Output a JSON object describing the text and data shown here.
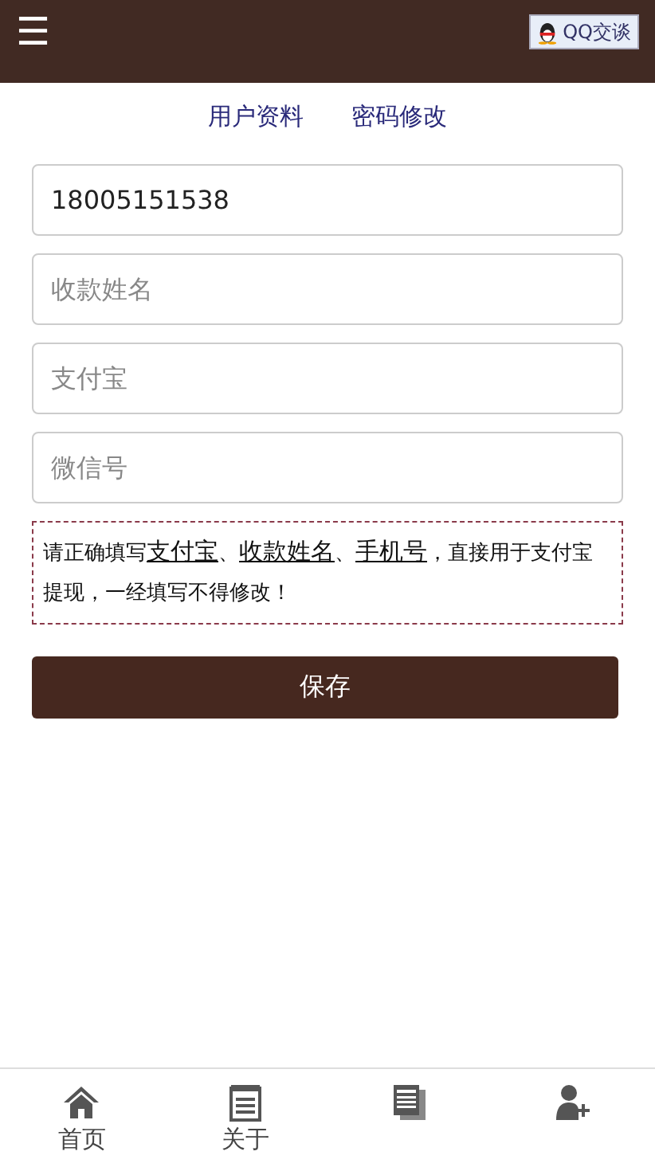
{
  "header": {
    "menu_icon": "☰",
    "qq_button": "QQ交谈"
  },
  "tabs": [
    {
      "label": "用户资料"
    },
    {
      "label": "密码修改"
    }
  ],
  "fields": [
    {
      "value": "18005151538"
    },
    {
      "placeholder": "收款姓名"
    },
    {
      "placeholder": "支付宝"
    },
    {
      "placeholder": "微信号"
    }
  ],
  "notice": [
    {
      "text": "请正确填写",
      "underline": false
    },
    {
      "text": "支付宝",
      "underline": true
    },
    {
      "text": "、",
      "underline": false
    },
    {
      "text": "收款姓名",
      "underline": true
    },
    {
      "text": "、",
      "underline": false
    },
    {
      "text": "手机号",
      "underline": true
    },
    {
      "text": "，直接用于支付宝提现，一经填写不得修改！",
      "underline": false
    }
  ],
  "save_button": "保存",
  "bottom_nav": [
    {
      "kind": "home",
      "label": "首页"
    },
    {
      "kind": "notepad",
      "label": "关于"
    },
    {
      "kind": "docs"
    },
    {
      "kind": "user-add"
    }
  ]
}
